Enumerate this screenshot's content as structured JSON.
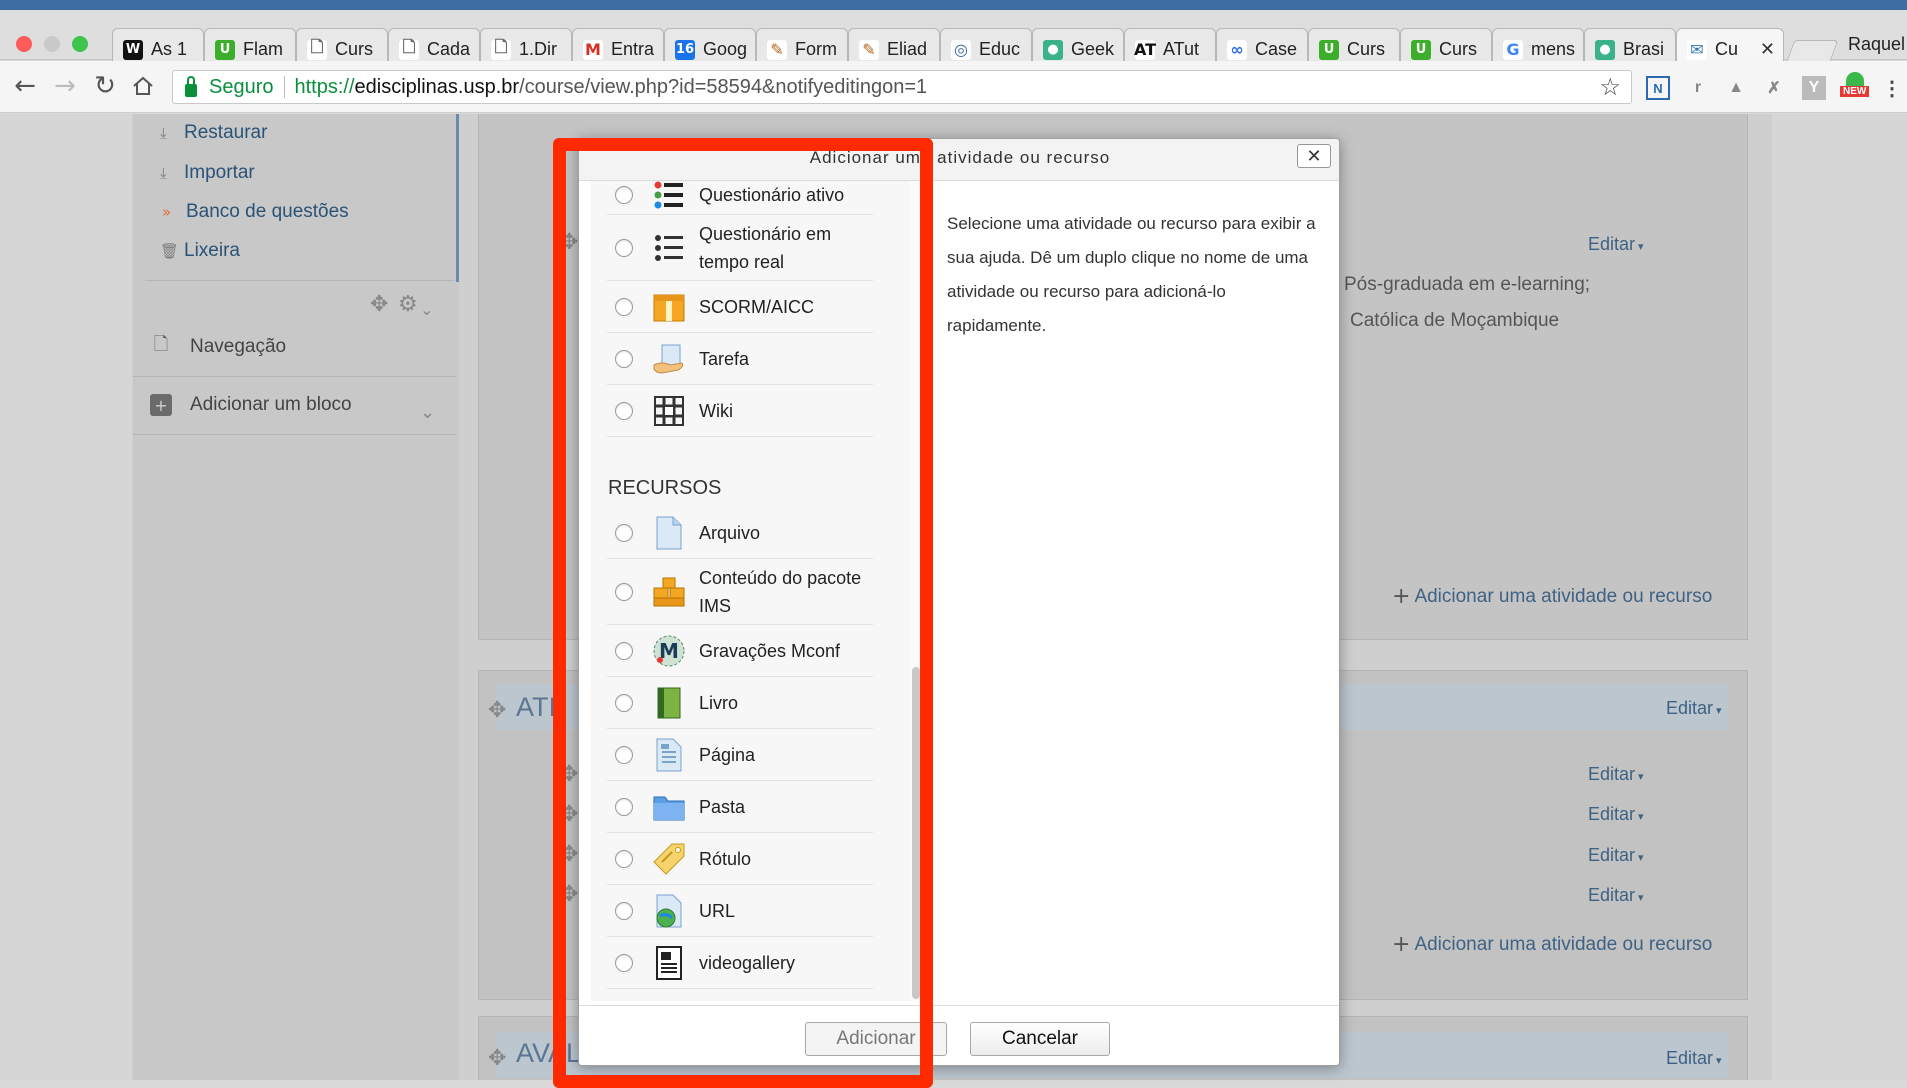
{
  "browser": {
    "tabs": [
      {
        "label": "As 1",
        "icon": "W",
        "color": "#111111",
        "fg": "#ffffff"
      },
      {
        "label": "Flam",
        "icon": "U",
        "color": "#3dae2b",
        "fg": "#ffffff"
      },
      {
        "label": "Curs",
        "icon": "doc",
        "color": "#ffffff",
        "fg": "#666666"
      },
      {
        "label": "Cada",
        "icon": "doc",
        "color": "#ffffff",
        "fg": "#666666"
      },
      {
        "label": "1.Dir",
        "icon": "doc",
        "color": "#ffffff",
        "fg": "#666666"
      },
      {
        "label": "Entra",
        "icon": "M",
        "color": "#ffffff",
        "fg": "#d93025"
      },
      {
        "label": "Goog",
        "icon": "16",
        "color": "#1a73e8",
        "fg": "#ffffff"
      },
      {
        "label": "Form",
        "icon": "paint",
        "color": "#ffffff",
        "fg": "#b5651d"
      },
      {
        "label": "Eliad",
        "icon": "paint",
        "color": "#ffffff",
        "fg": "#b5651d"
      },
      {
        "label": "Educ",
        "icon": "globe",
        "color": "#ffffff",
        "fg": "#3366aa"
      },
      {
        "label": "Geek",
        "icon": "leaf",
        "color": "#3bb28a",
        "fg": "#ffffff"
      },
      {
        "label": "ATut",
        "icon": "AT",
        "color": "#ffffff",
        "fg": "#111111"
      },
      {
        "label": "Case",
        "icon": "oo",
        "color": "#ffffff",
        "fg": "#2f6fd6"
      },
      {
        "label": "Curs",
        "icon": "U",
        "color": "#3dae2b",
        "fg": "#ffffff"
      },
      {
        "label": "Curs",
        "icon": "U",
        "color": "#3dae2b",
        "fg": "#ffffff"
      },
      {
        "label": "mens",
        "icon": "G",
        "color": "#ffffff",
        "fg": "#4285f4"
      },
      {
        "label": "Brasi",
        "icon": "leaf",
        "color": "#3bb28a",
        "fg": "#ffffff"
      },
      {
        "label": "Cu",
        "icon": "moodle",
        "color": "#ffffff",
        "fg": "#2a7ab0",
        "active": true
      }
    ],
    "profile_name": "Raquel",
    "secure_label": "Seguro",
    "url_scheme": "https://",
    "url_host": "edisciplinas.usp.br",
    "url_path": "/course/view.php?id=58594&notifyeditingon=1",
    "ext_badge": "NEW"
  },
  "sidebar": {
    "admin_links": [
      {
        "label": "Restaurar",
        "icon": "restore-icon"
      },
      {
        "label": "Importar",
        "icon": "import-icon"
      },
      {
        "label": "Banco de questões",
        "icon": "chevron-right-icon"
      },
      {
        "label": "Lixeira",
        "icon": "trash-icon"
      }
    ],
    "blocks": [
      {
        "label": "Navegação",
        "icon": "page-icon"
      },
      {
        "label": "Adicionar um bloco",
        "icon": "plus-square-icon"
      }
    ]
  },
  "course": {
    "section1": {
      "edit_label": "Editar",
      "desc_line1": "Pós-graduada em e-learning;",
      "desc_line2": "Católica de Moçambique",
      "add_label": "Adicionar uma atividade ou recurso"
    },
    "section2": {
      "title": "ATI",
      "edit_label": "Editar",
      "item_edit_labels": [
        "Editar",
        "Editar",
        "Editar",
        "Editar"
      ],
      "add_label": "Adicionar uma atividade ou recurso"
    },
    "section3": {
      "title": "AVAL",
      "edit_label": "Editar"
    }
  },
  "modal": {
    "title": "Adicionar uma atividade ou recurso",
    "close_label": "✕",
    "activities": [
      {
        "label": "Questionário ativo",
        "icon": "quiz-list-icon"
      },
      {
        "label": "Questionário em tempo real",
        "icon": "realtime-quiz-icon"
      },
      {
        "label": "SCORM/AICC",
        "icon": "scorm-package-icon"
      },
      {
        "label": "Tarefa",
        "icon": "assignment-hand-icon"
      },
      {
        "label": "Wiki",
        "icon": "wiki-icon"
      }
    ],
    "resources_title": "RECURSOS",
    "resources": [
      {
        "label": "Arquivo",
        "icon": "file-icon"
      },
      {
        "label": "Conteúdo do pacote IMS",
        "icon": "ims-package-icon"
      },
      {
        "label": "Gravações Mconf",
        "icon": "mconf-icon"
      },
      {
        "label": "Livro",
        "icon": "book-icon"
      },
      {
        "label": "Página",
        "icon": "page-icon"
      },
      {
        "label": "Pasta",
        "icon": "folder-icon"
      },
      {
        "label": "Rótulo",
        "icon": "label-tag-icon"
      },
      {
        "label": "URL",
        "icon": "url-globe-icon"
      },
      {
        "label": "videogallery",
        "icon": "videogallery-icon"
      }
    ],
    "help_text": "Selecione uma atividade ou recurso para exibir a sua ajuda. Dê um duplo clique no nome de uma atividade ou recurso para adicioná-lo rapidamente.",
    "add_button": "Adicionar",
    "cancel_button": "Cancelar"
  },
  "colors": {
    "highlight": "#ff2a00",
    "link": "#3f6284",
    "secure_green": "#0a8f3c"
  }
}
